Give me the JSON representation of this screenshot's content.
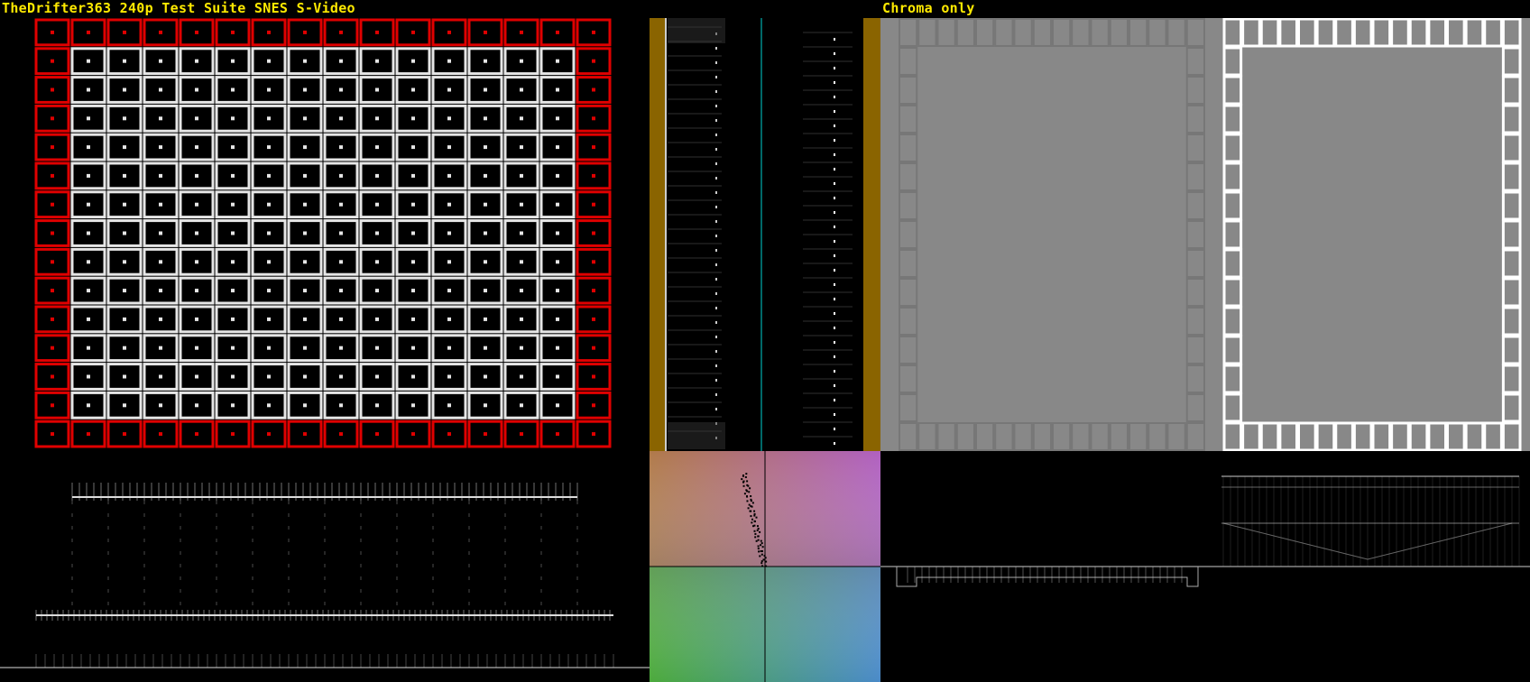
{
  "header": {
    "left_title": "TheDrifter363 240p Test Suite SNES S-Video",
    "right_title": "Chroma only"
  },
  "colors": {
    "title": "#ffea00",
    "grid_border_red": "#e00000",
    "grid_inner_white": "#e6e6e6",
    "background": "#000000",
    "chroma_gray": "#8a8a8a",
    "ochre_bar": "#8a6400",
    "cyan_line": "#00d0d0"
  },
  "panels": {
    "grid_test": "grid-pattern",
    "luma_waveform": "waveform-left",
    "parade": "waveform-parade",
    "vectorscope": "vectorscope",
    "chroma_view": "chroma-only-view",
    "chroma_waveform": "chroma-waveform"
  }
}
